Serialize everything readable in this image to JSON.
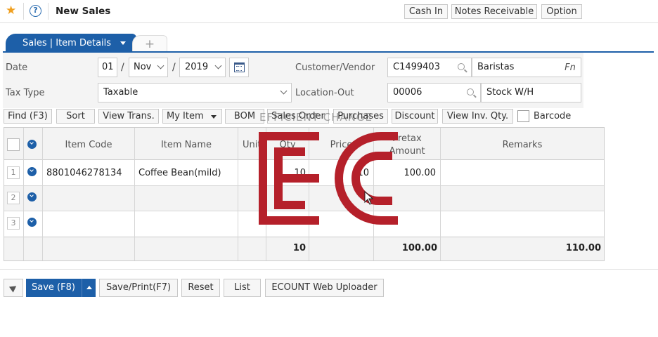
{
  "topbar": {
    "title": "New Sales",
    "help_glyph": "?",
    "star_glyph": "★",
    "buttons": [
      "Cash In",
      "Notes Receivable",
      "Option"
    ]
  },
  "tabs": {
    "active": "Sales | Item Details",
    "add": "+"
  },
  "form": {
    "date_label": "Date",
    "date_day": "01",
    "date_month": "Nov",
    "date_year": "2019",
    "date_sep": "/",
    "tax_type_label": "Tax Type",
    "tax_type_value": "Taxable",
    "customer_label": "Customer/Vendor",
    "customer_code": "C1499403",
    "customer_name": "Baristas",
    "fn_label": "Fn",
    "location_label": "Location-Out",
    "location_code": "00006",
    "location_name": "Stock W/H"
  },
  "toolbar": {
    "buttons": [
      "Find (F3)",
      "Sort",
      "View Trans.",
      "My Item",
      "BOM",
      "Sales Order",
      "Purchases",
      "Discount",
      "View Inv. Qty."
    ],
    "barcode_label": "Barcode"
  },
  "grid": {
    "headers": {
      "item_code": "Item Code",
      "item_name": "Item Name",
      "unit": "Unit",
      "qty": "Qty",
      "price": "Price",
      "pretax_1": "Pretax",
      "pretax_2": "Amount",
      "remarks": "Remarks"
    },
    "rows": [
      {
        "num": "1",
        "item_code": "8801046278134",
        "item_name": "Coffee Bean(mild)",
        "unit": "",
        "qty": "10",
        "price": "10",
        "pretax": "100.00",
        "remarks": ""
      },
      {
        "num": "2",
        "item_code": "",
        "item_name": "",
        "unit": "",
        "qty": "",
        "price": "",
        "pretax": "",
        "remarks": ""
      },
      {
        "num": "3",
        "item_code": "",
        "item_name": "",
        "unit": "",
        "qty": "",
        "price": "",
        "pretax": "",
        "remarks": ""
      }
    ],
    "totals": {
      "qty": "10",
      "pretax": "100.00",
      "remarks": "110.00"
    }
  },
  "bottom": {
    "save": "Save (F8)",
    "save_print": "Save/Print(F7)",
    "reset": "Reset",
    "list": "List",
    "uploader": "ECOUNT Web Uploader"
  },
  "watermark": {
    "text": "EFFICIENT CHANGE",
    "color": "#b5202a"
  },
  "colors": {
    "accent": "#1d5fa8",
    "star": "#f0a020"
  }
}
